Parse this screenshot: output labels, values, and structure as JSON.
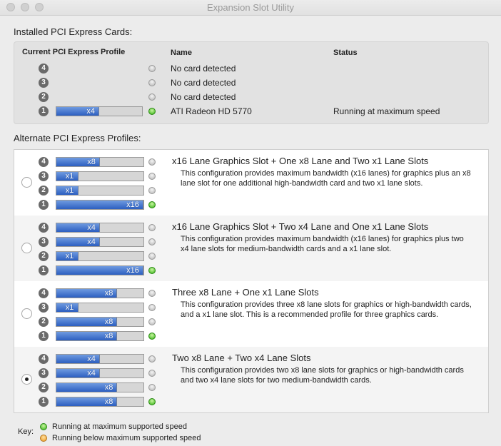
{
  "window": {
    "title": "Expansion Slot Utility"
  },
  "installed": {
    "title": "Installed PCI Express Cards:",
    "headers": {
      "profile": "Current PCI Express Profile",
      "name": "Name",
      "status": "Status"
    },
    "rows": [
      {
        "slot": "4",
        "lane_label": "",
        "fill": 0,
        "led": "gray",
        "name": "No card detected",
        "status": ""
      },
      {
        "slot": "3",
        "lane_label": "",
        "fill": 0,
        "led": "gray",
        "name": "No card detected",
        "status": ""
      },
      {
        "slot": "2",
        "lane_label": "",
        "fill": 0,
        "led": "gray",
        "name": "No card detected",
        "status": ""
      },
      {
        "slot": "1",
        "lane_label": "x4",
        "fill": 0.5,
        "led": "green",
        "name": "ATI Radeon HD 5770",
        "status": "Running at maximum speed"
      }
    ]
  },
  "alternate": {
    "title": "Alternate PCI Express Profiles:",
    "profiles": [
      {
        "selected": false,
        "title": "x16 Lane Graphics Slot + One x8 Lane and Two x1 Lane Slots",
        "description": "This configuration provides maximum bandwidth (x16 lanes) for graphics plus an x8 lane slot for one additional high-bandwidth card and two x1 lane slots.",
        "slots": [
          {
            "slot": "4",
            "lane_label": "x8",
            "fill": 0.5,
            "led": "gray"
          },
          {
            "slot": "3",
            "lane_label": "x1",
            "fill": 0.25,
            "led": "gray"
          },
          {
            "slot": "2",
            "lane_label": "x1",
            "fill": 0.25,
            "led": "gray"
          },
          {
            "slot": "1",
            "lane_label": "x16",
            "fill": 1.0,
            "led": "green"
          }
        ]
      },
      {
        "selected": false,
        "title": "x16 Lane Graphics Slot + Two x4 Lane and One x1 Lane Slots",
        "description": "This configuration provides maximum bandwidth (x16 lanes) for graphics plus two x4 lane slots for medium-bandwidth cards and a x1 lane slot.",
        "slots": [
          {
            "slot": "4",
            "lane_label": "x4",
            "fill": 0.5,
            "led": "gray"
          },
          {
            "slot": "3",
            "lane_label": "x4",
            "fill": 0.5,
            "led": "gray"
          },
          {
            "slot": "2",
            "lane_label": "x1",
            "fill": 0.25,
            "led": "gray"
          },
          {
            "slot": "1",
            "lane_label": "x16",
            "fill": 1.0,
            "led": "green"
          }
        ]
      },
      {
        "selected": false,
        "title": "Three x8 Lane + One x1 Lane Slots",
        "description": "This configuration provides three x8 lane slots for graphics or high-bandwidth cards, and a x1 lane slot.  This is a recommended profile for three graphics cards.",
        "slots": [
          {
            "slot": "4",
            "lane_label": "x8",
            "fill": 0.7,
            "led": "gray"
          },
          {
            "slot": "3",
            "lane_label": "x1",
            "fill": 0.25,
            "led": "gray"
          },
          {
            "slot": "2",
            "lane_label": "x8",
            "fill": 0.7,
            "led": "gray"
          },
          {
            "slot": "1",
            "lane_label": "x8",
            "fill": 0.7,
            "led": "green"
          }
        ]
      },
      {
        "selected": true,
        "title": "Two x8 Lane + Two x4 Lane Slots",
        "description": "This configuration provides two x8 lane slots for graphics or high-bandwidth cards and two x4 lane slots for two medium-bandwidth cards.",
        "slots": [
          {
            "slot": "4",
            "lane_label": "x4",
            "fill": 0.5,
            "led": "gray"
          },
          {
            "slot": "3",
            "lane_label": "x4",
            "fill": 0.5,
            "led": "gray"
          },
          {
            "slot": "2",
            "lane_label": "x8",
            "fill": 0.7,
            "led": "gray"
          },
          {
            "slot": "1",
            "lane_label": "x8",
            "fill": 0.7,
            "led": "green"
          }
        ]
      }
    ]
  },
  "key": {
    "label": "Key:",
    "items": [
      {
        "led": "green",
        "text": "Running at maximum supported speed"
      },
      {
        "led": "orange",
        "text": "Running below maximum supported speed"
      }
    ]
  },
  "colors": {
    "accent_blue": "#2c5fc0",
    "led_green": "#34b214",
    "led_orange": "#ee9b22"
  }
}
